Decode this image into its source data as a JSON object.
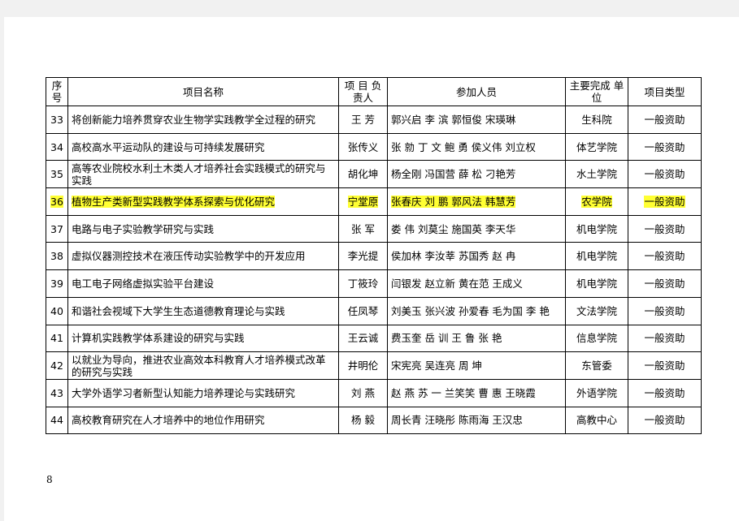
{
  "headers": {
    "no": "序号",
    "name": "项目名称",
    "lead": "项 目 负责人",
    "members": "参加人员",
    "unit": "主要完成 单 位",
    "type": "项目类型"
  },
  "rows": [
    {
      "no": "33",
      "name": "将创新能力培养贯穿农业生物学实践教学全过程的研究",
      "lead": "王 芳",
      "members": "郭兴启 李 滨 郭恒俊 宋瑛琳",
      "unit": "生科院",
      "type": "一般资助",
      "highlight": false
    },
    {
      "no": "34",
      "name": "高校高水平运动队的建设与可持续发展研究",
      "lead": "张传义",
      "members": "张 勍 丁 文 鲍 勇 侯义伟 刘立权",
      "unit": "体艺学院",
      "type": "一般资助",
      "highlight": false
    },
    {
      "no": "35",
      "name": "高等农业院校水利土木类人才培养社会实践模式的研究与实践",
      "lead": "胡化坤",
      "members": "杨全刚 冯国营 薛 松 刁艳芳",
      "unit": "水土学院",
      "type": "一般资助",
      "highlight": false
    },
    {
      "no": "36",
      "name": "植物生产类新型实践教学体系探索与优化研究",
      "lead": "宁堂原",
      "members": "张春庆 刘 鹏 郭风法 韩慧芳",
      "unit": "农学院",
      "type": "一般资助",
      "highlight": true
    },
    {
      "no": "37",
      "name": "电路与电子实验教学研究与实践",
      "lead": "张 军",
      "members": "娄 伟 刘莫尘 施国英 李天华",
      "unit": "机电学院",
      "type": "一般资助",
      "highlight": false
    },
    {
      "no": "38",
      "name": "虚拟仪器测控技术在液压传动实验教学中的开发应用",
      "lead": "李光提",
      "members": "侯加林 李汝莘 苏国秀 赵 冉",
      "unit": "机电学院",
      "type": "一般资助",
      "highlight": false
    },
    {
      "no": "39",
      "name": "电工电子网络虚拟实验平台建设",
      "lead": "丁筱玲",
      "members": "闫银发 赵立新 黄在范 王成义",
      "unit": "机电学院",
      "type": "一般资助",
      "highlight": false
    },
    {
      "no": "40",
      "name": "和谐社会视域下大学生生态道德教育理论与实践",
      "lead": "任凤琴",
      "members": "刘美玉 张兴波 孙爱春 毛为国 李 艳",
      "unit": "文法学院",
      "type": "一般资助",
      "highlight": false
    },
    {
      "no": "41",
      "name": "计算机实践教学体系建设的研究与实践",
      "lead": "王云诚",
      "members": "费玉奎 岳 训 王 鲁 张 艳",
      "unit": "信息学院",
      "type": "一般资助",
      "highlight": false
    },
    {
      "no": "42",
      "name": "以就业为导向，推进农业高效本科教育人才培养模式改革的研究与实践",
      "lead": "井明伦",
      "members": "宋宪亮 吴连亮 周 坤",
      "unit": "东管委",
      "type": "一般资助",
      "highlight": false
    },
    {
      "no": "43",
      "name": "大学外语学习者新型认知能力培养理论与实践研究",
      "lead": "刘 燕",
      "members": "赵 燕 苏 一 兰笑笑 曹 惠 王晓霞",
      "unit": "外语学院",
      "type": "一般资助",
      "highlight": false
    },
    {
      "no": "44",
      "name": "高校教育研究在人才培养中的地位作用研究",
      "lead": "杨 毅",
      "members": "周长青 汪晓彤 陈雨海 王汉忠",
      "unit": "高教中心",
      "type": "一般资助",
      "highlight": false
    }
  ],
  "page_number": "8",
  "colors": {
    "highlight": "#ffff33",
    "page_bg": "#ffffff",
    "canvas_bg": "#f1f1f1"
  }
}
